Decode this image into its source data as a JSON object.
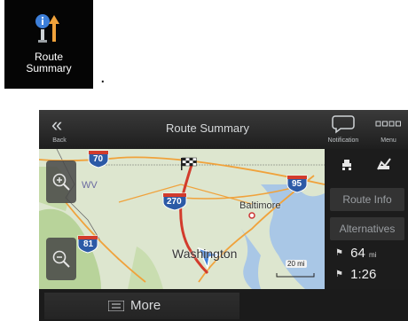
{
  "feature_tile": {
    "label": "Route\nSummary"
  },
  "after_tile_text": ".",
  "header": {
    "back_label": "Back",
    "title": "Route Summary",
    "notification_label": "Notification",
    "menu_label": "Menu"
  },
  "map": {
    "highway_shields": [
      "70",
      "95",
      "270",
      "81"
    ],
    "state_label": "WV",
    "cities": [
      "Baltimore",
      "Washington"
    ],
    "scale": "20 mi"
  },
  "panel": {
    "route_info_label": "Route Info",
    "alternatives_label": "Alternatives",
    "distance_value": "64",
    "distance_unit": "mi",
    "time_value": "1:26"
  },
  "footer": {
    "more_label": "More"
  },
  "colors": {
    "highway_red": "#d23b2c",
    "route_orange": "#f0a23b",
    "interstate_blue": "#2c5aa6",
    "water": "#a9c7e6"
  }
}
